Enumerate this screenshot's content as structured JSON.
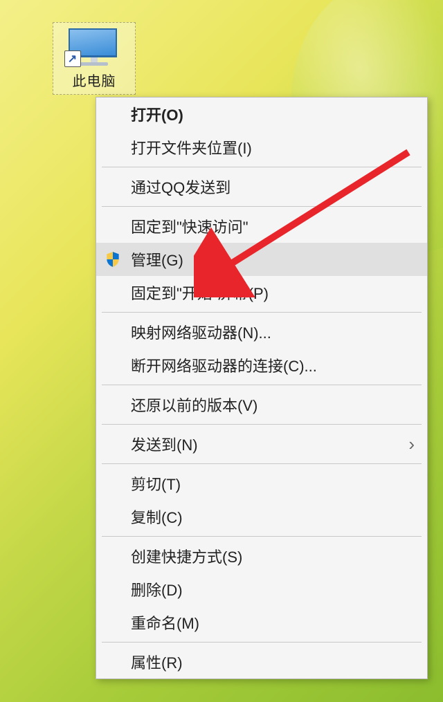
{
  "desktop_icon": {
    "label": "此电脑",
    "shortcut_badge": "↗"
  },
  "context_menu": {
    "items": [
      {
        "label": "打开(O)",
        "bold": true
      },
      {
        "label": "打开文件夹位置(I)"
      },
      {
        "sep": true
      },
      {
        "label": "通过QQ发送到"
      },
      {
        "sep": true
      },
      {
        "label": "固定到\"快速访问\""
      },
      {
        "label": "管理(G)",
        "icon": "shield",
        "highlighted": true
      },
      {
        "label": "固定到\"开始\"屏幕(P)"
      },
      {
        "sep": true
      },
      {
        "label": "映射网络驱动器(N)..."
      },
      {
        "label": "断开网络驱动器的连接(C)..."
      },
      {
        "sep": true
      },
      {
        "label": "还原以前的版本(V)"
      },
      {
        "sep": true
      },
      {
        "label": "发送到(N)",
        "submenu": true
      },
      {
        "sep": true
      },
      {
        "label": "剪切(T)"
      },
      {
        "label": "复制(C)"
      },
      {
        "sep": true
      },
      {
        "label": "创建快捷方式(S)"
      },
      {
        "label": "删除(D)"
      },
      {
        "label": "重命名(M)"
      },
      {
        "sep": true
      },
      {
        "label": "属性(R)"
      }
    ]
  }
}
